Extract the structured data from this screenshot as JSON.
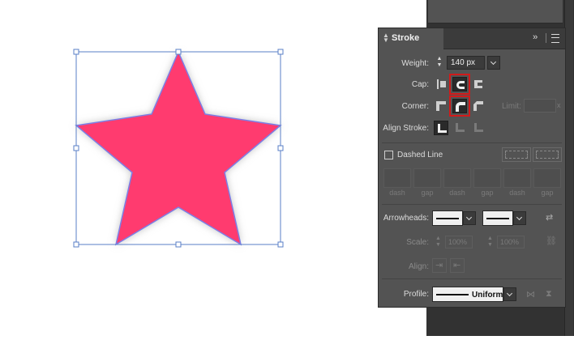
{
  "colors": {
    "star_fill": "#ff3b6f",
    "star_stroke": "#7b7fe6",
    "selection": "#5a7fc7",
    "panel_bg": "#535353",
    "highlight": "#d21a1a"
  },
  "panel": {
    "title": "Stroke",
    "collapse_icon": "double-chevron-right-icon",
    "menu_icon": "hamburger-menu-icon"
  },
  "weight": {
    "label": "Weight:",
    "value": "140 px"
  },
  "cap": {
    "label": "Cap:",
    "options": [
      "butt-cap",
      "round-cap",
      "projecting-cap"
    ],
    "selected": "round-cap"
  },
  "corner": {
    "label": "Corner:",
    "options": [
      "miter-join",
      "round-join",
      "bevel-join"
    ],
    "selected": "round-join",
    "limit_label": "Limit:",
    "limit_unit": "x"
  },
  "align_stroke": {
    "label": "Align Stroke:",
    "options": [
      "align-center",
      "align-inside",
      "align-outside"
    ],
    "selected": "align-center"
  },
  "dashed": {
    "label": "Dashed Line",
    "checked": false,
    "labels": [
      "dash",
      "gap",
      "dash",
      "gap",
      "dash",
      "gap"
    ]
  },
  "arrowheads": {
    "label": "Arrowheads:",
    "scale_label": "Scale:",
    "scale_start": "100%",
    "scale_end": "100%",
    "align_label": "Align:"
  },
  "profile": {
    "label": "Profile:",
    "value": "Uniform"
  }
}
